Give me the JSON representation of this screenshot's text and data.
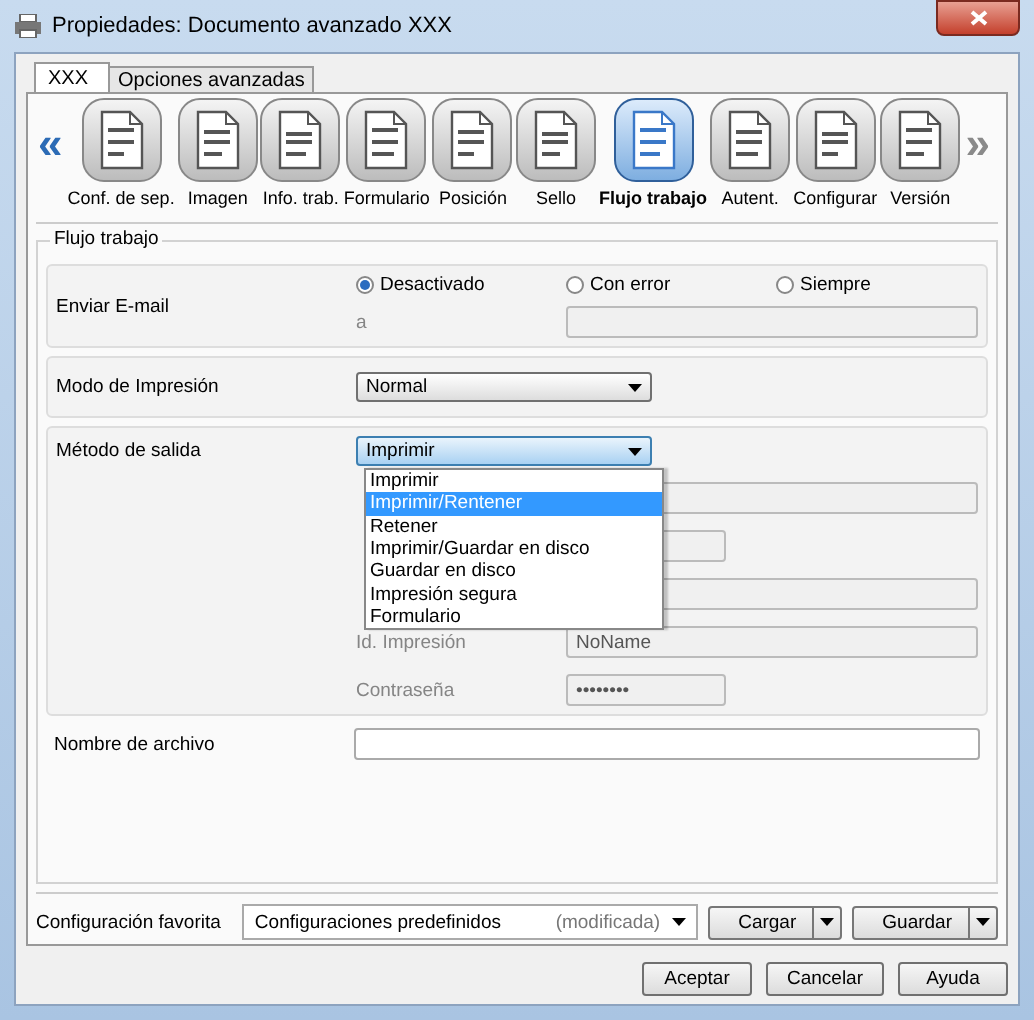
{
  "window": {
    "title": "Propiedades: Documento avanzado XXX"
  },
  "tabs": [
    {
      "label": "XXX",
      "selected": true
    },
    {
      "label": "Opciones avanzadas",
      "selected": false
    }
  ],
  "toolbar": {
    "prev": "«",
    "next": "»",
    "items": [
      {
        "label": "Conf. de sep.",
        "selected": false
      },
      {
        "label": "Imagen",
        "selected": false
      },
      {
        "label": "Info. trab.",
        "selected": false
      },
      {
        "label": "Formulario",
        "selected": false
      },
      {
        "label": "Posición",
        "selected": false
      },
      {
        "label": "Sello",
        "selected": false
      },
      {
        "label": "Flujo trabajo",
        "selected": true
      },
      {
        "label": "Autent.",
        "selected": false
      },
      {
        "label": "Configurar",
        "selected": false
      },
      {
        "label": "Versión",
        "selected": false
      }
    ]
  },
  "group": {
    "title": "Flujo trabajo",
    "email": {
      "label": "Enviar E-mail",
      "options": [
        {
          "label": "Desactivado",
          "selected": true
        },
        {
          "label": "Con error",
          "selected": false
        },
        {
          "label": "Siempre",
          "selected": false
        }
      ],
      "to_label": "a",
      "to_disabled": true
    },
    "print_mode": {
      "label": "Modo de Impresión",
      "value": "Normal"
    },
    "output_method": {
      "label": "Método de salida",
      "value": "Imprimir",
      "expanded": true,
      "options": [
        {
          "label": "Imprimir",
          "highlighted": false
        },
        {
          "label": "Imprimir/Rentener",
          "highlighted": true
        },
        {
          "label": "Retener",
          "highlighted": false
        },
        {
          "label": "Imprimir/Guardar en disco",
          "highlighted": false
        },
        {
          "label": "Guardar en disco",
          "highlighted": false
        },
        {
          "label": "Impresión segura",
          "highlighted": false
        },
        {
          "label": "Formulario",
          "highlighted": false
        }
      ],
      "fields": [
        {
          "kind": "wide",
          "disabled": true
        },
        {
          "kind": "short",
          "disabled": true
        },
        {
          "kind": "wide",
          "disabled": true
        },
        {
          "kind": "wide",
          "label": "Id. Impresión",
          "value": "NoName",
          "disabled": true
        },
        {
          "kind": "short",
          "label": "Contraseña",
          "value": "••••••••",
          "disabled": true
        }
      ]
    },
    "file_name": {
      "label": "Nombre de archivo"
    }
  },
  "favorites": {
    "label": "Configuración favorita",
    "value": "Configuraciones predefinidos",
    "status": "(modificada)",
    "buttons": [
      "Cargar",
      "Guardar"
    ]
  },
  "buttons": [
    "Aceptar",
    "Cancelar",
    "Ayuda"
  ]
}
